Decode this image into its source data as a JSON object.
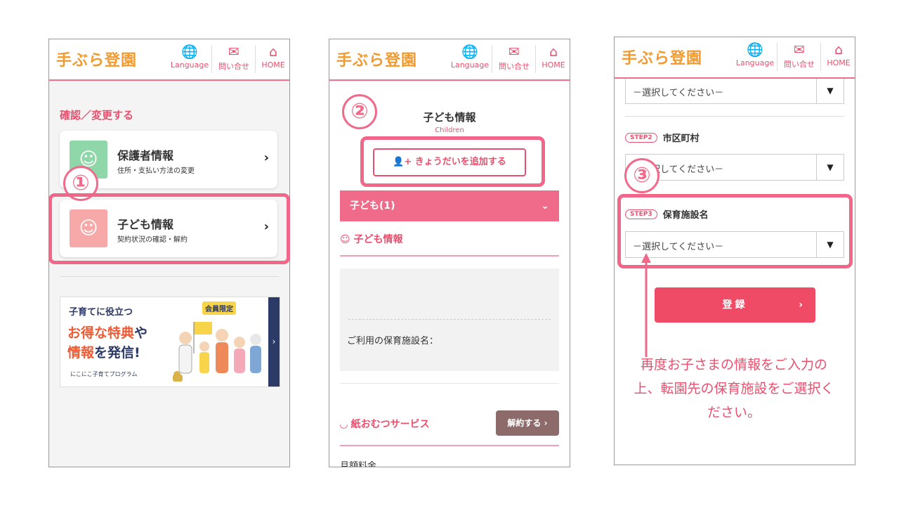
{
  "brand": {
    "logo": "手ぶら登園"
  },
  "header": {
    "language": "Language",
    "contact": "問い合せ",
    "home": "HOME"
  },
  "phone1": {
    "section_title": "確認／変更する",
    "card1": {
      "title": "保護者情報",
      "sub": "住所・支払い方法の変更"
    },
    "card2": {
      "title": "子ども情報",
      "sub": "契約状況の確認・解約"
    },
    "marker": "①",
    "banner": {
      "line1": "子育てに役立つ",
      "line2a": "お得な特典",
      "line2b": "や",
      "line3a": "情報",
      "line3b": "を発信!",
      "badge": "会員限定",
      "footer": "にこにこ子育てプログラム"
    }
  },
  "phone2": {
    "marker": "②",
    "title": "子ども情報",
    "subtitle": "Children",
    "add_sibling": "きょうだいを追加する",
    "child_bar": "子ども(1)",
    "child_info": "子ども情報",
    "facility_label": "ご利用の保育施設名：",
    "diaper": "紙おむつサービス",
    "cancel": "解約する",
    "monthly": "月額料金"
  },
  "phone3": {
    "marker": "③",
    "select_placeholder": "－選択してください－",
    "step2_tag": "STEP2",
    "step2_label": "市区町村",
    "step3_tag": "STEP3",
    "step3_label": "保育施設名",
    "register": "登録"
  },
  "note": "再度お子さまの情報をご入力の上、転園先の保育施設をご選択ください。",
  "colors": {
    "accent": "#f06a8a",
    "brand_orange": "#f29a2e",
    "cancel_brown": "#8e6b6b"
  }
}
